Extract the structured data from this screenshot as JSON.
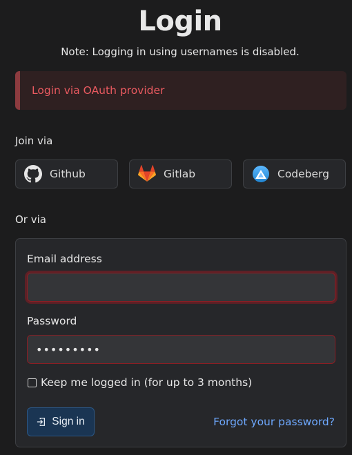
{
  "header": {
    "title": "Login",
    "note": "Note: Logging in using usernames is disabled."
  },
  "alert": {
    "message": "Login via OAuth provider",
    "color": "#ea5a60"
  },
  "oauth": {
    "join_label": "Join via",
    "providers": [
      {
        "label": "Github",
        "icon": "github-icon"
      },
      {
        "label": "Gitlab",
        "icon": "gitlab-icon"
      },
      {
        "label": "Codeberg",
        "icon": "codeberg-icon"
      }
    ]
  },
  "form": {
    "or_label": "Or via",
    "email_label": "Email address",
    "email_value": "",
    "password_label": "Password",
    "password_value": "•••••••••",
    "remember_label": "Keep me logged in (for up to 3 months)",
    "remember_checked": false,
    "signin_label": "Sign in",
    "forgot_label": "Forgot your password?"
  },
  "colors": {
    "background": "#1c1c1d",
    "accent_link": "#6ea8fe",
    "error_border": "#8b1e24",
    "primary_button": "#1a3553"
  }
}
